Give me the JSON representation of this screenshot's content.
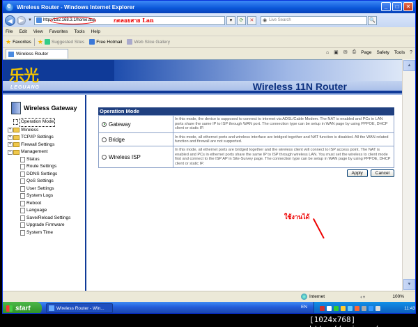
{
  "window": {
    "title": "Wireless Router - Windows Internet Explorer"
  },
  "address": {
    "url": "http://192.168.3.1/home.asp",
    "handwritten_note": "กดลอยสาย Lan",
    "search_placeholder": "Live Search"
  },
  "menu": [
    "File",
    "Edit",
    "View",
    "Favorites",
    "Tools",
    "Help"
  ],
  "favorites_bar": {
    "label": "Favorites",
    "items": [
      {
        "label": "Suggested Sites",
        "muted": true
      },
      {
        "label": "Free Hotmail",
        "muted": false
      },
      {
        "label": "Web Slice Gallery",
        "muted": true
      }
    ]
  },
  "tab": {
    "label": "Wireless Router"
  },
  "command_bar": {
    "page": "Page",
    "safety": "Safety",
    "tools": "Tools"
  },
  "banner": {
    "logo_cn": "乐光",
    "logo_en": "LEGUANG",
    "product": "Wireless 11N Router"
  },
  "nav": {
    "title": "Wireless Gateway",
    "items": [
      {
        "label": "Operation Mode",
        "level": 1,
        "type": "page",
        "selected": true
      },
      {
        "label": "Wireless",
        "level": 1,
        "type": "folder",
        "expander": "+"
      },
      {
        "label": "TCP/IP Settings",
        "level": 1,
        "type": "folder",
        "expander": "+"
      },
      {
        "label": "Firewall Settings",
        "level": 1,
        "type": "folder",
        "expander": "+"
      },
      {
        "label": "Management",
        "level": 1,
        "type": "folder",
        "expander": "−"
      },
      {
        "label": "Status",
        "level": 2,
        "type": "page"
      },
      {
        "label": "Route Settings",
        "level": 2,
        "type": "page"
      },
      {
        "label": "DDNS Settings",
        "level": 2,
        "type": "page"
      },
      {
        "label": "QoS Settings",
        "level": 2,
        "type": "page"
      },
      {
        "label": "User Settings",
        "level": 2,
        "type": "page"
      },
      {
        "label": "System Logs",
        "level": 2,
        "type": "page"
      },
      {
        "label": "Reboot",
        "level": 2,
        "type": "page"
      },
      {
        "label": "Language",
        "level": 2,
        "type": "page"
      },
      {
        "label": "Save/Reload Settings",
        "level": 2,
        "type": "page"
      },
      {
        "label": "Upgrade Firmware",
        "level": 2,
        "type": "page"
      },
      {
        "label": "System Time",
        "level": 2,
        "type": "page"
      }
    ]
  },
  "operation_mode": {
    "header": "Operation Mode",
    "options": [
      {
        "label": "Gateway",
        "selected": true,
        "description": "In this mode, the device is supposed to connect to internet via ADSL/Cable Modem. The NAT is enabled and PCs in LAN ports share the same IP to ISP through WAN port. The connection type can be setup in WAN page by using PPPOE, DHCP client or static IP."
      },
      {
        "label": "Bridge",
        "selected": false,
        "description": "In this mode, all ethernet ports and wireless interface are bridged together and NAT function is disabled. All the WAN related function and firewall are not supported."
      },
      {
        "label": "Wireless ISP",
        "selected": false,
        "description": "In this mode, all ethernet ports are bridged together and the wireless client will connect to ISP access point. The NAT is enabled and PCs in ethernet ports share the same IP to ISP through wireless LAN. You must set the wireless to client mode first and connect to the ISP AP in Site-Survey page. The connection type can be setup in WAN page by using PPPOE, DHCP client or static IP."
      }
    ],
    "apply": "Apply",
    "cancel": "Cancel"
  },
  "annotation": "ใช้งานได้",
  "status_bar": {
    "zone": "Internet",
    "zoom": "100%"
  },
  "taskbar": {
    "start": "start",
    "item": "Wireless Router - Win...",
    "lang": "EN",
    "clock": "11:43"
  },
  "watermark": "[1024x768] http://upic.me/"
}
